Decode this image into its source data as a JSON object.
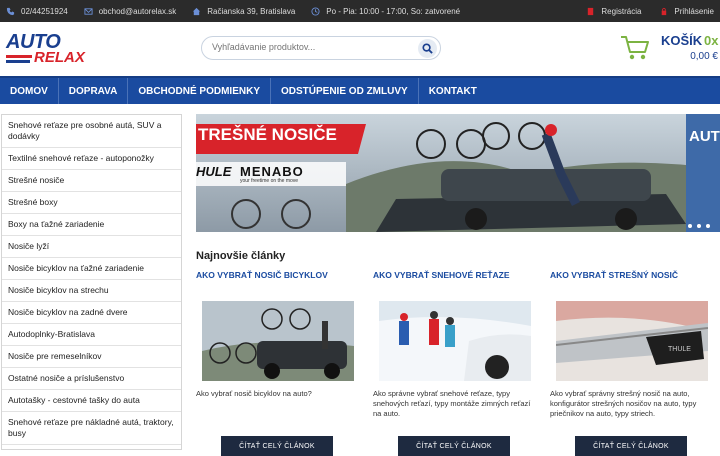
{
  "topbar": {
    "phone": "02/44251924",
    "email": "obchod@autorelax.sk",
    "address": "Račianska 39, Bratislava",
    "hours": "Po - Pia: 10:00 - 17:00, So: zatvorené",
    "register": "Registrácia",
    "login": "Prihlásenie"
  },
  "logo": {
    "line1": "AUTO",
    "line2": "RELAX"
  },
  "search": {
    "placeholder": "Vyhľadávanie produktov..."
  },
  "cart": {
    "title": "KOŠÍK",
    "count": "0x",
    "price": "0,00 €"
  },
  "nav": {
    "items": [
      "DOMOV",
      "DOPRAVA",
      "OBCHODNÉ PODMIENKY",
      "ODSTÚPENIE OD ZMLUVY",
      "KONTAKT"
    ]
  },
  "sidebar": {
    "items": [
      "Snehové reťaze pre osobné autá, SUV a dodávky",
      "Textilné snehové reťaze - autoponožky",
      "Strešné nosiče",
      "Strešné boxy",
      "Boxy na ťažné zariadenie",
      "Nosiče lyží",
      "Nosiče bicyklov na ťažné zariadenie",
      "Nosiče bicyklov na strechu",
      "Nosiče bicyklov na zadné dvere",
      "Autodoplnky-Bratislava",
      "Nosiče pre remeselníkov",
      "Ostatné nosiče a príslušenstvo",
      "Autotašky - cestovné tašky do auta",
      "Snehové reťaze pre nákladné autá, traktory, busy"
    ]
  },
  "banner": {
    "heading": "TREŠNÉ NOSIČE",
    "brand1": "HULE",
    "brand2": "MENABO",
    "brand2_tag": "your freetime on the move",
    "side_text": "AUT"
  },
  "articles": {
    "section_title": "Najnovšie články",
    "items": [
      {
        "title": "AKO VYBRAŤ NOSIČ BICYKLOV",
        "desc": "Ako vybrať nosič bicyklov na auto?",
        "button": "ČÍTAŤ CELÝ ČLÁNOK"
      },
      {
        "title": "AKO VYBRAŤ SNEHOVÉ REŤAZE",
        "desc": "Ako správne vybrať snehové reťaze, typy snehových reťazí, typy montáže zimných reťazí na auto.",
        "button": "ČÍTAŤ CELÝ ČLÁNOK"
      },
      {
        "title": "AKO VYBRAŤ STREŠNÝ NOSIČ",
        "desc": "Ako vybrať správny strešný nosič na auto, konfigurátor strešných nosičov na auto, typy priečnikov na auto, typy striech.",
        "button": "ČÍTAŤ CELÝ ČLÁNOK"
      }
    ]
  },
  "colors": {
    "brand_blue": "#1a4ba0",
    "brand_red": "#d8232a",
    "cart_green": "#7cb342",
    "topbar": "#2b2b2b"
  },
  "icons": [
    "phone-icon",
    "email-icon",
    "home-icon",
    "clock-icon",
    "register-icon",
    "login-icon",
    "search-icon",
    "cart-icon"
  ]
}
